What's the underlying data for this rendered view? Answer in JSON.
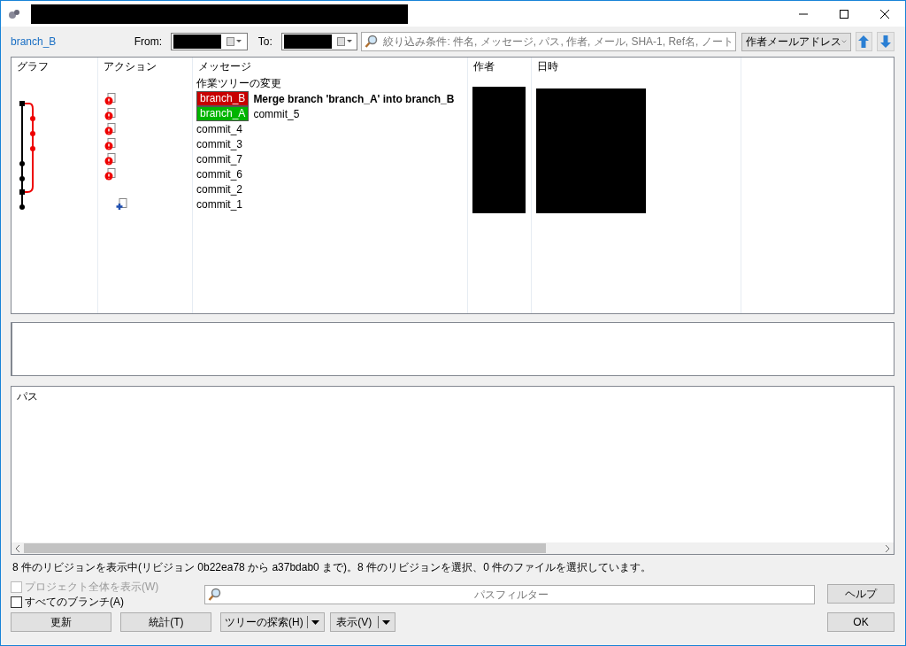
{
  "toolbar": {
    "branch": "branch_B",
    "from_label": "From:",
    "to_label": "To:",
    "filter_placeholder": "絞り込み条件: 件名, メッセージ, パス, 作者, メール, SHA-1, Ref名, ノート",
    "filter_mode": "作者メールアドレス"
  },
  "log": {
    "columns": [
      "グラフ",
      "アクション",
      "メッセージ",
      "作者",
      "日時"
    ],
    "rows": [
      {
        "kind": "none",
        "refs": [],
        "message": "作業ツリーの変更",
        "bold": false
      },
      {
        "kind": "modified",
        "refs": [
          {
            "label": "branch_B",
            "color": "#c80000"
          }
        ],
        "message": "Merge branch 'branch_A' into branch_B",
        "bold": true
      },
      {
        "kind": "modified",
        "refs": [
          {
            "label": "branch_A",
            "color": "#00b400"
          }
        ],
        "message": "commit_5",
        "bold": false
      },
      {
        "kind": "modified",
        "refs": [],
        "message": "commit_4",
        "bold": false
      },
      {
        "kind": "modified",
        "refs": [],
        "message": "commit_3",
        "bold": false
      },
      {
        "kind": "modified",
        "refs": [],
        "message": "commit_7",
        "bold": false
      },
      {
        "kind": "modified",
        "refs": [],
        "message": "commit_6",
        "bold": false
      },
      {
        "kind": "none",
        "refs": [],
        "message": "commit_2",
        "bold": false
      },
      {
        "kind": "added",
        "refs": [],
        "message": "commit_1",
        "bold": false
      }
    ]
  },
  "files": {
    "columns": [
      "パス"
    ]
  },
  "status": "8 件のリビジョンを表示中(リビジョン 0b22ea78 から a37bdab0 まで)。8 件のリビジョンを選択、0 件のファイルを選択しています。",
  "options": [
    {
      "label": "プロジェクト全体を表示(W)",
      "checked": false,
      "disabled": true
    },
    {
      "label": "すべてのブランチ(A)",
      "checked": false,
      "disabled": false
    }
  ],
  "path_filter_placeholder": "パスフィルター",
  "buttons": {
    "refresh": "更新",
    "stats": "統計(T)",
    "browse": "ツリーの探索(H)",
    "view": "表示(V)",
    "help": "ヘルプ",
    "ok": "OK"
  }
}
